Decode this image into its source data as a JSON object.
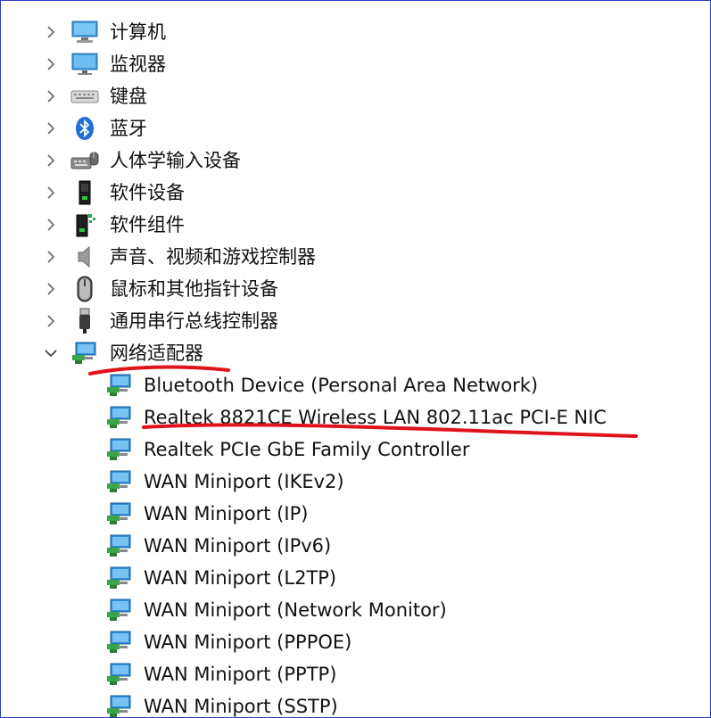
{
  "categories": [
    {
      "label": "计算机",
      "icon": "computer-icon",
      "expanded": false
    },
    {
      "label": "监视器",
      "icon": "monitor-icon",
      "expanded": false
    },
    {
      "label": "键盘",
      "icon": "keyboard-icon",
      "expanded": false
    },
    {
      "label": "蓝牙",
      "icon": "bluetooth-icon",
      "expanded": false
    },
    {
      "label": "人体学输入设备",
      "icon": "hid-icon",
      "expanded": false
    },
    {
      "label": "软件设备",
      "icon": "software-device-icon",
      "expanded": false
    },
    {
      "label": "软件组件",
      "icon": "software-component-icon",
      "expanded": false
    },
    {
      "label": "声音、视频和游戏控制器",
      "icon": "speaker-icon",
      "expanded": false
    },
    {
      "label": "鼠标和其他指针设备",
      "icon": "mouse-icon",
      "expanded": false
    },
    {
      "label": "通用串行总线控制器",
      "icon": "usb-icon",
      "expanded": false
    },
    {
      "label": "网络适配器",
      "icon": "network-adapter-icon",
      "expanded": true
    }
  ],
  "network_adapters": [
    "Bluetooth Device (Personal Area Network)",
    "Realtek 8821CE Wireless LAN 802.11ac PCI-E NIC",
    "Realtek PCIe GbE Family Controller",
    "WAN Miniport (IKEv2)",
    "WAN Miniport (IP)",
    "WAN Miniport (IPv6)",
    "WAN Miniport (L2TP)",
    "WAN Miniport (Network Monitor)",
    "WAN Miniport (PPPOE)",
    "WAN Miniport (PPTP)",
    "WAN Miniport (SSTP)"
  ],
  "colors": {
    "frame_border": "#2a3fbf",
    "annotation_red": "#e0121b",
    "network_icon_blue": "#2f8fd8",
    "network_icon_green": "#3aa64a"
  }
}
